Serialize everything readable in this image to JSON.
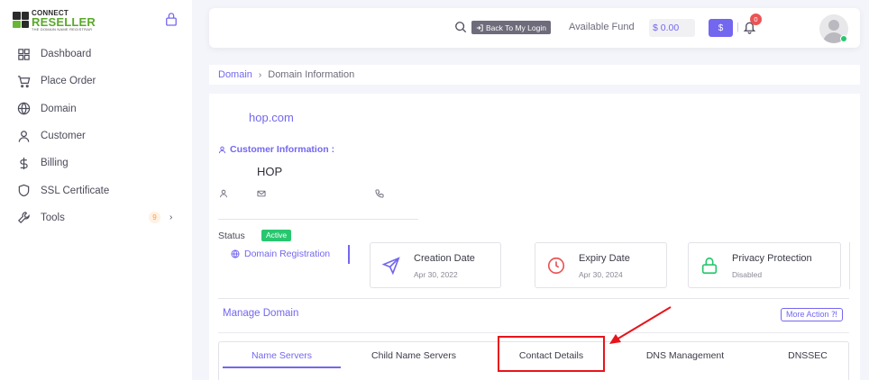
{
  "brand": {
    "line1": "CONNECT",
    "line2": "RESELLER",
    "line3": "THE DOMAIN NAME REGISTRAR"
  },
  "sidebar": {
    "items": [
      {
        "label": "Dashboard",
        "icon": "grid-icon"
      },
      {
        "label": "Place Order",
        "icon": "cart-icon"
      },
      {
        "label": "Domain",
        "icon": "globe-icon"
      },
      {
        "label": "Customer",
        "icon": "user-icon"
      },
      {
        "label": "Billing",
        "icon": "dollar-icon"
      },
      {
        "label": "SSL Certificate",
        "icon": "shield-icon"
      },
      {
        "label": "Tools",
        "icon": "wrench-icon",
        "badge": "9"
      }
    ]
  },
  "navbar": {
    "back_label": "Back To My Login",
    "fund_label": "Available Fund",
    "fund_value": "$ 0.00",
    "dollar_label": "$",
    "notification_count": "0"
  },
  "breadcrumb": {
    "parent": "Domain",
    "current": "Domain Information"
  },
  "domain": {
    "name": "hop.com",
    "customer_info_label": "Customer Information :",
    "customer_name": "HOP"
  },
  "status": {
    "label": "Status",
    "value": "Active",
    "registration_link": "Domain Registration"
  },
  "info_boxes": {
    "creation": {
      "title": "Creation Date",
      "sub": "Apr 30, 2022"
    },
    "expiry": {
      "title": "Expiry Date",
      "sub": "Apr 30, 2024"
    },
    "privacy": {
      "title": "Privacy Protection",
      "sub": "Disabled"
    }
  },
  "manage": {
    "title": "Manage Domain",
    "more_action": "More Action ⁈"
  },
  "tabs": [
    {
      "label": "Name Servers",
      "active": true
    },
    {
      "label": "Child Name Servers"
    },
    {
      "label": "Contact Details"
    },
    {
      "label": "DNS Management"
    },
    {
      "label": "DNSSEC"
    }
  ],
  "colors": {
    "primary": "#7367f0",
    "success": "#28c76f",
    "danger": "#ea5455",
    "annotation": "#e8141b"
  }
}
